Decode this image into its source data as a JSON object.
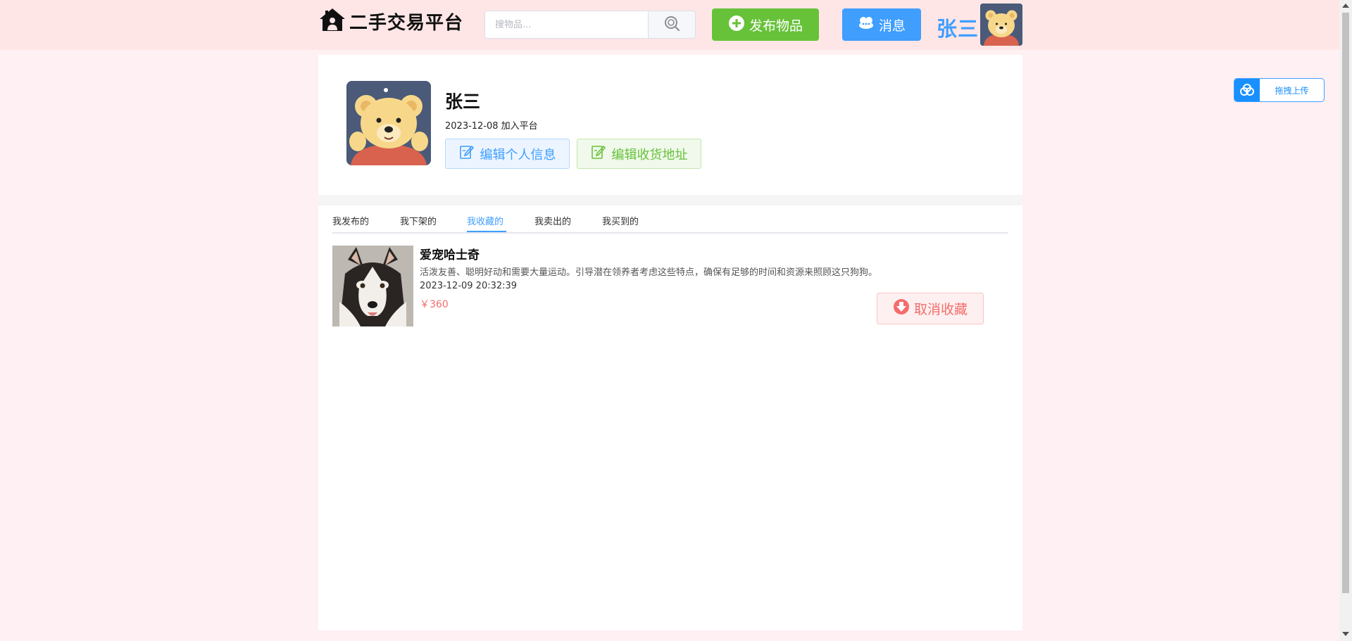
{
  "header": {
    "logo_text": "二手交易平台",
    "search_placeholder": "搜物品...",
    "publish_label": "发布物品",
    "messages_label": "消息",
    "user_name": "张三"
  },
  "profile": {
    "name": "张三",
    "joined": "2023-12-08 加入平台",
    "edit_info_label": "编辑个人信息",
    "edit_address_label": "编辑收货地址"
  },
  "tabs": [
    {
      "label": "我发布的",
      "active": false
    },
    {
      "label": "我下架的",
      "active": false
    },
    {
      "label": "我收藏的",
      "active": true
    },
    {
      "label": "我卖出的",
      "active": false
    },
    {
      "label": "我买到的",
      "active": false
    }
  ],
  "items": [
    {
      "title": "爱宠哈士奇",
      "description": "活泼友善、聪明好动和需要大量运动。引导潜在领养者考虑这些特点，确保有足够的时间和资源来照顾这只狗狗。",
      "time": "2023-12-09 20:32:39",
      "price": "￥360",
      "action_label": "取消收藏"
    }
  ],
  "upload_widget": {
    "label": "拖拽上传"
  },
  "colors": {
    "header_bg": "#ffe6e6",
    "page_bg": "#fff0f3",
    "primary": "#409eff",
    "success": "#67c23a",
    "danger": "#f56c6c"
  },
  "icons": {
    "logo": "home-icon",
    "search": "search-icon",
    "publish": "plus-circle-icon",
    "messages": "chat-icon",
    "edit_info": "edit-icon",
    "edit_address": "edit-icon",
    "unfavorite": "download-icon",
    "upload": "cloud-icon"
  }
}
